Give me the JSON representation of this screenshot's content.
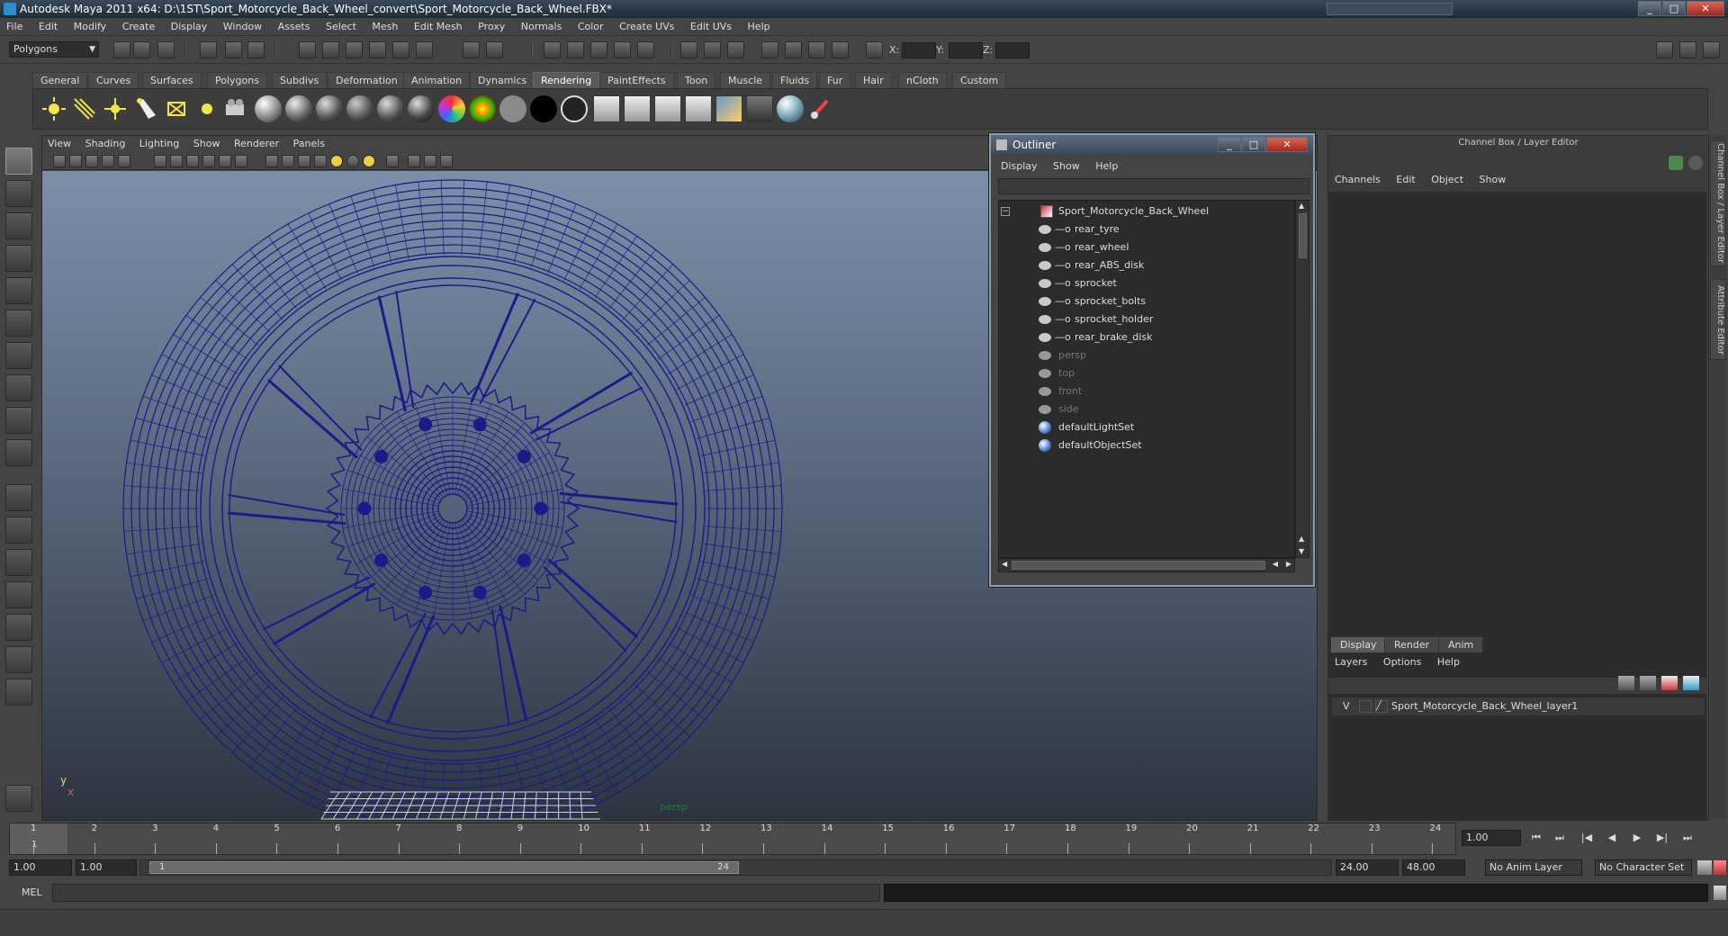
{
  "window": {
    "title": "Autodesk Maya 2011 x64: D:\\1ST\\Sport_Motorcycle_Back_Wheel_convert\\Sport_Motorcycle_Back_Wheel.FBX*",
    "controls": [
      "_",
      "□",
      "✕"
    ]
  },
  "menubar": [
    "File",
    "Edit",
    "Modify",
    "Create",
    "Display",
    "Window",
    "Assets",
    "Select",
    "Mesh",
    "Edit Mesh",
    "Proxy",
    "Normals",
    "Color",
    "Create UVs",
    "Edit UVs",
    "Help"
  ],
  "statusline": {
    "mode": "Polygons",
    "coord_labels": [
      "X:",
      "Y:",
      "Z:"
    ]
  },
  "shelf": {
    "tabs": [
      "General",
      "Curves",
      "Surfaces",
      "Polygons",
      "Subdivs",
      "Deformation",
      "Animation",
      "Dynamics",
      "Rendering",
      "PaintEffects",
      "Toon",
      "Muscle",
      "Fluids",
      "Fur",
      "Hair",
      "nCloth",
      "Custom"
    ],
    "active_tab": "Rendering"
  },
  "viewport": {
    "menu": [
      "View",
      "Shading",
      "Lighting",
      "Show",
      "Renderer",
      "Panels"
    ],
    "camera_label": "persp",
    "axis_y": "y",
    "axis_x": "x",
    "wire_color": "#1a1a8a"
  },
  "outliner": {
    "title": "Outliner",
    "menu": [
      "Display",
      "Show",
      "Help"
    ],
    "root": "Sport_Motorcycle_Back_Wheel",
    "children": [
      "rear_tyre",
      "rear_wheel",
      "rear_ABS_disk",
      "sprocket",
      "sprocket_bolts",
      "sprocket_holder",
      "rear_brake_disk"
    ],
    "cameras": [
      "persp",
      "top",
      "front",
      "side"
    ],
    "sets": [
      "defaultLightSet",
      "defaultObjectSet"
    ]
  },
  "channelbox": {
    "title": "Channel Box / Layer Editor",
    "menu": [
      "Channels",
      "Edit",
      "Object",
      "Show"
    ],
    "layer_tabs": [
      "Display",
      "Render",
      "Anim"
    ],
    "layer_menu": [
      "Layers",
      "Options",
      "Help"
    ],
    "layer": {
      "visible": "V",
      "name": "Sport_Motorcycle_Back_Wheel_layer1"
    },
    "side_tabs": [
      "Channel Box / Layer Editor",
      "Attribute Editor"
    ]
  },
  "timeline": {
    "ticks": [
      "1",
      "2",
      "3",
      "4",
      "5",
      "6",
      "7",
      "8",
      "9",
      "10",
      "11",
      "12",
      "13",
      "14",
      "15",
      "16",
      "17",
      "18",
      "19",
      "20",
      "21",
      "22",
      "23",
      "24"
    ],
    "current_frame_marker": "1",
    "current_frame": "1.00",
    "playback_buttons": [
      "⏮",
      "⏭",
      "|◀",
      "◀",
      "▶",
      "▶|",
      "⏭"
    ]
  },
  "range": {
    "start": "1.00",
    "playback_start": "1.00",
    "handle_start": "1",
    "handle_end": "24",
    "playback_end": "24.00",
    "end": "48.00",
    "anim_layer": "No Anim Layer",
    "character_set": "No Character Set"
  },
  "commandline": {
    "label": "MEL"
  }
}
